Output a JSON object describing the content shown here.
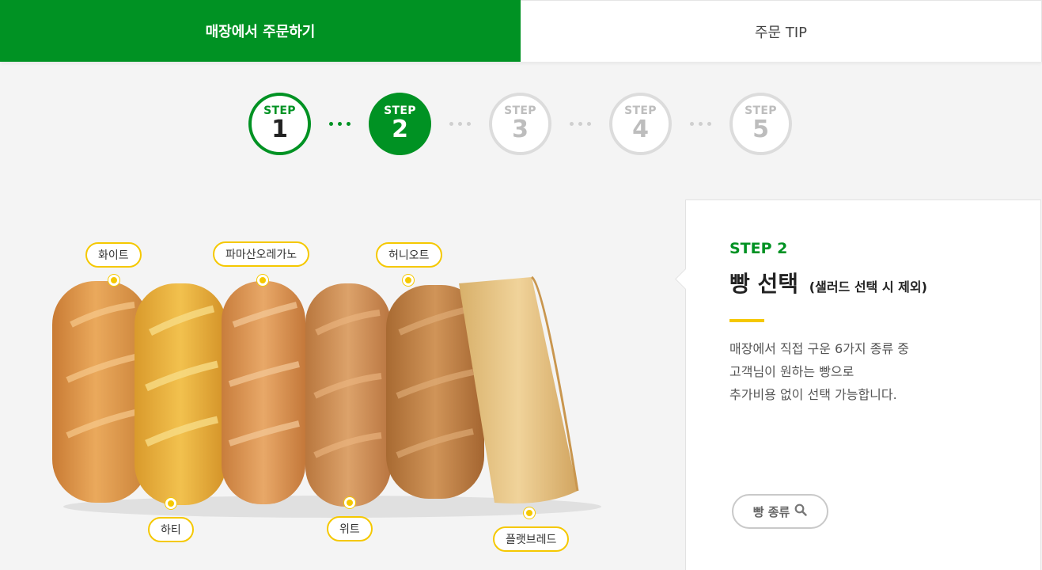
{
  "tabs": [
    {
      "label": "매장에서 주문하기",
      "active": true
    },
    {
      "label": "주문 TIP",
      "active": false
    }
  ],
  "steps": [
    {
      "label": "STEP",
      "number": "1",
      "state": "done"
    },
    {
      "label": "STEP",
      "number": "2",
      "state": "current"
    },
    {
      "label": "STEP",
      "number": "3",
      "state": "todo"
    },
    {
      "label": "STEP",
      "number": "4",
      "state": "todo"
    },
    {
      "label": "STEP",
      "number": "5",
      "state": "todo"
    }
  ],
  "breads": {
    "white": "화이트",
    "hearty": "하티",
    "parmesan_oregano": "파마산오레가노",
    "wheat": "위트",
    "honey_oat": "허니오트",
    "flatbread": "플랫브레드"
  },
  "card": {
    "step": "STEP 2",
    "title": "빵 선택",
    "title_note": "(샐러드 선택 시 제외)",
    "desc_lines": [
      "매장에서 직접 구운 6가지 종류 중",
      "고객님이 원하는 빵으로",
      "추가비용 없이 선택 가능합니다."
    ],
    "button_label": "빵 종류",
    "button_icon": "search-icon"
  },
  "colors": {
    "brand_green": "#009223",
    "accent_yellow": "#f5c800"
  }
}
